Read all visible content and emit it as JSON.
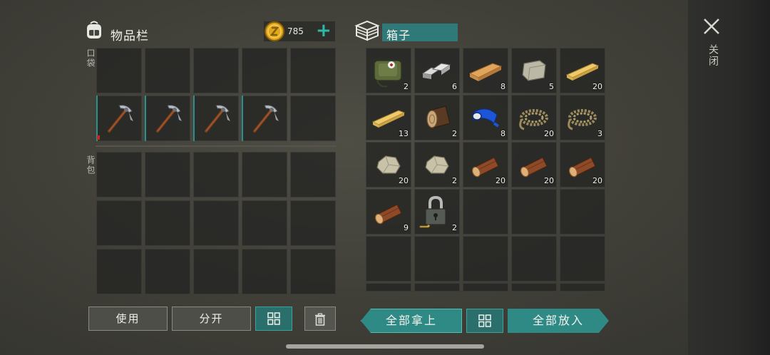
{
  "inventory": {
    "title": "物品栏",
    "coins": "785",
    "coin_plus": "+",
    "pocket_label": "口袋",
    "backpack_label": "背包",
    "pocket_slots": [
      {
        "icon": "",
        "qty": ""
      },
      {
        "icon": "",
        "qty": ""
      },
      {
        "icon": "",
        "qty": ""
      },
      {
        "icon": "",
        "qty": ""
      },
      {
        "icon": "",
        "qty": ""
      },
      {
        "icon": "pickaxe-icon",
        "qty": ""
      },
      {
        "icon": "pickaxe-icon",
        "qty": ""
      },
      {
        "icon": "pickaxe-icon",
        "qty": ""
      },
      {
        "icon": "pickaxe-icon",
        "qty": ""
      },
      {
        "icon": "",
        "qty": ""
      }
    ],
    "backpack_slot_count": 15
  },
  "container": {
    "title": "箱子",
    "slots": [
      {
        "icon": "first-aid-bag-icon",
        "qty": "2"
      },
      {
        "icon": "metal-ingot-icon",
        "qty": "6"
      },
      {
        "icon": "wood-plank-icon",
        "qty": "8"
      },
      {
        "icon": "stone-block-icon",
        "qty": "5"
      },
      {
        "icon": "wood-board-icon",
        "qty": "20"
      },
      {
        "icon": "wood-board-icon",
        "qty": "13"
      },
      {
        "icon": "log-stump-icon",
        "qty": "2"
      },
      {
        "icon": "blue-tape-icon",
        "qty": "8"
      },
      {
        "icon": "rope-icon",
        "qty": "20"
      },
      {
        "icon": "rope-icon",
        "qty": "3"
      },
      {
        "icon": "stone-icon",
        "qty": "20"
      },
      {
        "icon": "stone-icon",
        "qty": "2"
      },
      {
        "icon": "log-icon",
        "qty": "20"
      },
      {
        "icon": "log-icon",
        "qty": "20"
      },
      {
        "icon": "log-icon",
        "qty": "20"
      },
      {
        "icon": "log-icon",
        "qty": "9"
      },
      {
        "icon": "padlock-icon",
        "qty": "2"
      },
      {
        "icon": "",
        "qty": ""
      },
      {
        "icon": "",
        "qty": ""
      },
      {
        "icon": "",
        "qty": ""
      }
    ]
  },
  "buttons": {
    "use": "使用",
    "split": "分开",
    "take_all": "全部拿上",
    "put_all": "全部放入"
  },
  "close_label": "关闭",
  "colors": {
    "accent": "#2f8a85",
    "coin": "#e0a81c"
  }
}
